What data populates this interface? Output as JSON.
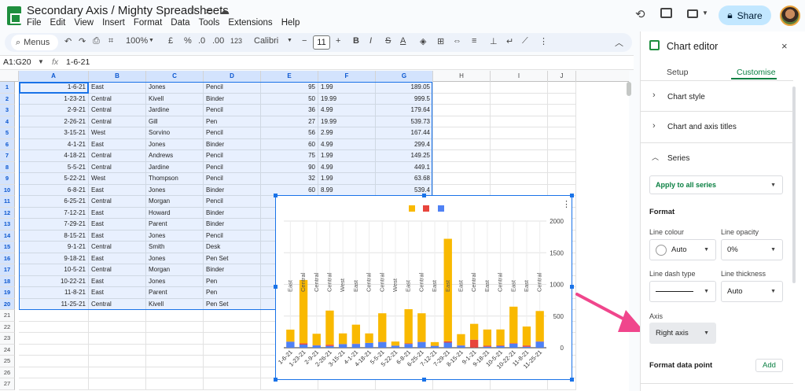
{
  "app": {
    "title": "Secondary Axis / Mighty Spreadsheets",
    "menu": [
      "File",
      "Edit",
      "View",
      "Insert",
      "Format",
      "Data",
      "Tools",
      "Extensions",
      "Help"
    ],
    "share_label": "Share"
  },
  "toolbar": {
    "menus_label": "Menus",
    "zoom": "100%",
    "currency": "£",
    "percent": "%",
    "dec_less": ".0",
    "dec_more": ".00",
    "number_fmt": "123",
    "font": "Calibri",
    "font_size": "11",
    "bold": "B",
    "italic": "I",
    "strike": "S",
    "text_color": "A"
  },
  "formula_bar": {
    "name_box": "A1:G20",
    "fx": "fx",
    "value": "1-6-21"
  },
  "grid": {
    "columns": [
      "A",
      "B",
      "C",
      "D",
      "E",
      "F",
      "G",
      "H",
      "I",
      "J"
    ],
    "rows": [
      [
        "1-6-21",
        "East",
        "Jones",
        "Pencil",
        "95",
        "1.99",
        "189.05"
      ],
      [
        "1-23-21",
        "Central",
        "Kivell",
        "Binder",
        "50",
        "19.99",
        "999.5"
      ],
      [
        "2-9-21",
        "Central",
        "Jardine",
        "Pencil",
        "36",
        "4.99",
        "179.64"
      ],
      [
        "2-26-21",
        "Central",
        "Gill",
        "Pen",
        "27",
        "19.99",
        "539.73"
      ],
      [
        "3-15-21",
        "West",
        "Sorvino",
        "Pencil",
        "56",
        "2.99",
        "167.44"
      ],
      [
        "4-1-21",
        "East",
        "Jones",
        "Binder",
        "60",
        "4.99",
        "299.4"
      ],
      [
        "4-18-21",
        "Central",
        "Andrews",
        "Pencil",
        "75",
        "1.99",
        "149.25"
      ],
      [
        "5-5-21",
        "Central",
        "Jardine",
        "Pencil",
        "90",
        "4.99",
        "449.1"
      ],
      [
        "5-22-21",
        "West",
        "Thompson",
        "Pencil",
        "32",
        "1.99",
        "63.68"
      ],
      [
        "6-8-21",
        "East",
        "Jones",
        "Binder",
        "60",
        "8.99",
        "539.4"
      ],
      [
        "6-25-21",
        "Central",
        "Morgan",
        "Pencil",
        "",
        "",
        ""
      ],
      [
        "7-12-21",
        "East",
        "Howard",
        "Binder",
        "",
        "",
        ""
      ],
      [
        "7-29-21",
        "East",
        "Parent",
        "Binder",
        "",
        "",
        ""
      ],
      [
        "8-15-21",
        "East",
        "Jones",
        "Pencil",
        "",
        "",
        ""
      ],
      [
        "9-1-21",
        "Central",
        "Smith",
        "Desk",
        "",
        "",
        ""
      ],
      [
        "9-18-21",
        "East",
        "Jones",
        "Pen Set",
        "",
        "",
        ""
      ],
      [
        "10-5-21",
        "Central",
        "Morgan",
        "Binder",
        "",
        "",
        ""
      ],
      [
        "10-22-21",
        "East",
        "Jones",
        "Pen",
        "",
        "",
        ""
      ],
      [
        "11-8-21",
        "East",
        "Parent",
        "Pen",
        "",
        "",
        ""
      ],
      [
        "11-25-21",
        "Central",
        "Kivell",
        "Pen Set",
        "",
        "",
        ""
      ]
    ],
    "row_count": 27
  },
  "chart_data": {
    "type": "bar",
    "categories": [
      "1-6-21",
      "1-23-21",
      "2-9-21",
      "2-26-21",
      "3-15-21",
      "4-1-21",
      "4-18-21",
      "5-5-21",
      "5-22-21",
      "6-8-21",
      "6-25-21",
      "7-12-21",
      "7-29-21",
      "8-15-21",
      "9-1-21",
      "9-18-21",
      "10-5-21",
      "10-22-21",
      "11-8-21",
      "11-25-21"
    ],
    "region_labels": [
      "East",
      "Central",
      "Central",
      "Central",
      "West",
      "East",
      "Central",
      "Central",
      "West",
      "East",
      "Central",
      "East",
      "East",
      "East",
      "Central",
      "East",
      "Central",
      "East",
      "East",
      "Central"
    ],
    "series": [
      {
        "values": [
          95,
          50,
          36,
          27,
          56,
          60,
          75,
          90,
          32,
          60,
          90,
          29,
          81,
          35,
          2,
          16,
          28,
          64,
          15,
          96
        ],
        "color": "#4f81f4"
      },
      {
        "values": [
          1.99,
          19.99,
          4.99,
          19.99,
          2.99,
          4.99,
          1.99,
          4.99,
          1.99,
          8.99,
          4.99,
          1.99,
          19.99,
          4.99,
          125,
          15.99,
          8.99,
          8.99,
          19.99,
          4.99
        ],
        "color": "#e8453c"
      },
      {
        "values": [
          189.05,
          999.5,
          179.64,
          539.73,
          167.44,
          299.4,
          149.25,
          449.1,
          63.68,
          539.4,
          449.1,
          57.71,
          1619.19,
          174.65,
          250,
          255.84,
          251.72,
          575.36,
          299.85,
          479.04
        ],
        "color": "#f9b900"
      }
    ],
    "stacked": true,
    "ylim": [
      0,
      2000
    ],
    "yticks": [
      0,
      500,
      1000,
      1500,
      2000
    ],
    "y_axis_side": "right",
    "legend": "top"
  },
  "editor": {
    "title": "Chart editor",
    "close": "×",
    "tabs": [
      "Setup",
      "Customise"
    ],
    "active_tab": "Customise",
    "sections": [
      "Chart style",
      "Chart and axis titles",
      "Series"
    ],
    "apply_to": "Apply to all series",
    "format_heading": "Format",
    "line_colour_label": "Line colour",
    "line_colour_value": "Auto",
    "line_opacity_label": "Line opacity",
    "line_opacity_value": "0%",
    "line_dash_label": "Line dash type",
    "line_thickness_label": "Line thickness",
    "line_thickness_value": "Auto",
    "axis_label": "Axis",
    "axis_value": "Right axis",
    "format_data_point": "Format data point",
    "add_label": "Add"
  },
  "colors": {
    "accent": "#1a73e8",
    "green": "#0b8043",
    "arrow": "#f0468c",
    "share_bg": "#c2e7ff"
  }
}
